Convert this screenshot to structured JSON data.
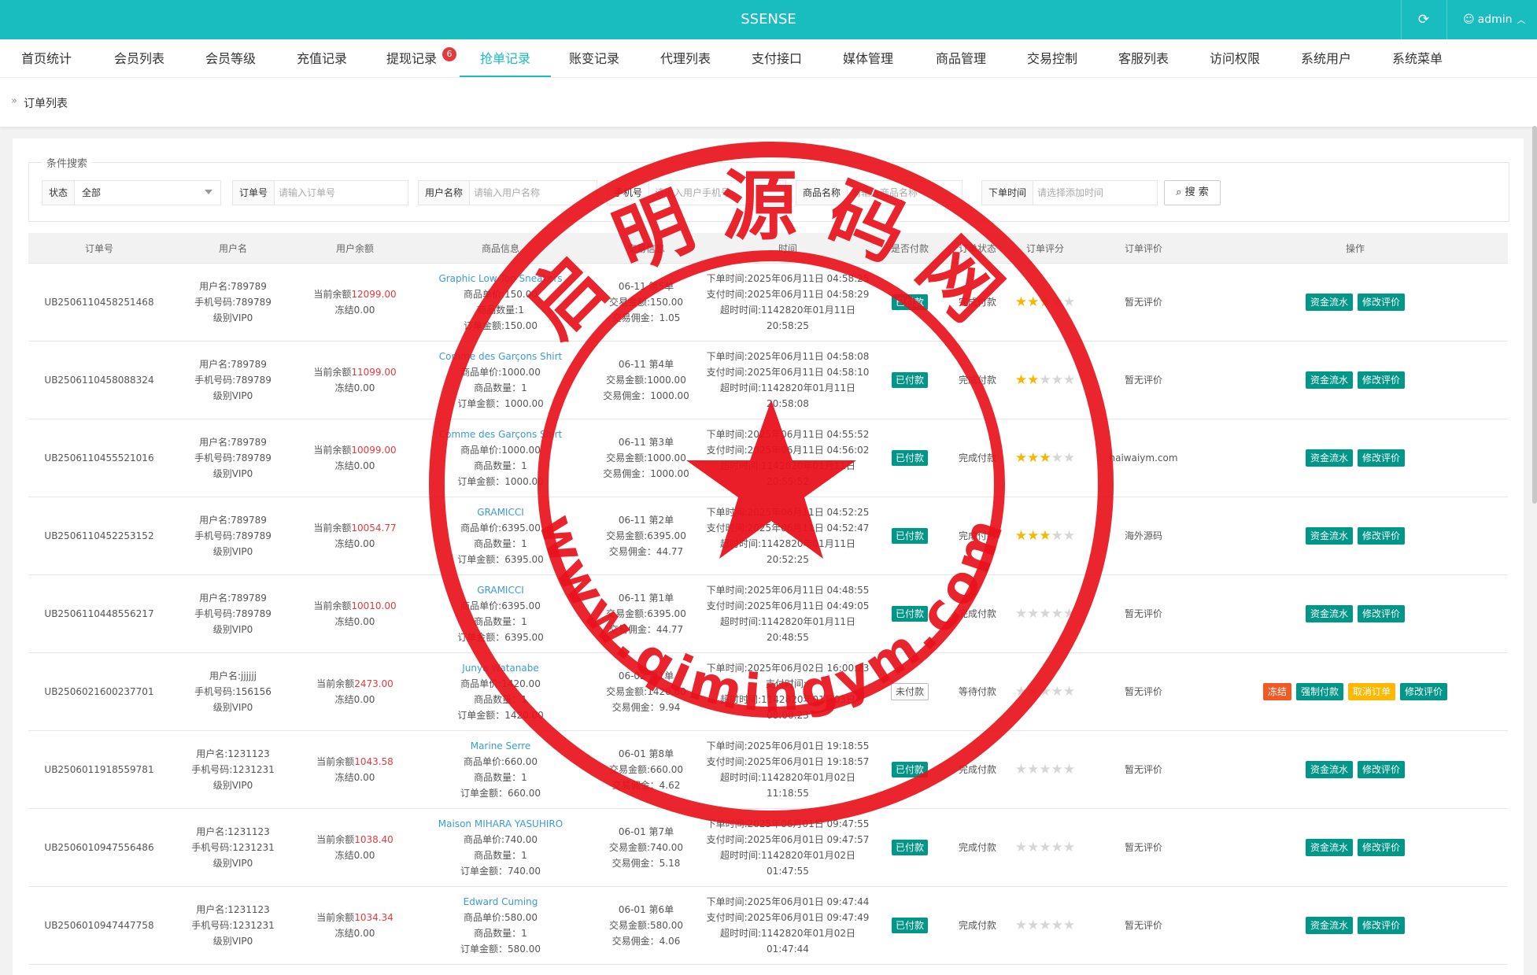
{
  "app": {
    "title": "SSENSE",
    "refresh_icon": "refresh-icon",
    "user": "admin"
  },
  "nav": [
    {
      "label": "首页统计"
    },
    {
      "label": "会员列表"
    },
    {
      "label": "会员等级"
    },
    {
      "label": "充值记录"
    },
    {
      "label": "提现记录",
      "badge": "6"
    },
    {
      "label": "抢单记录",
      "active": true
    },
    {
      "label": "账变记录"
    },
    {
      "label": "代理列表"
    },
    {
      "label": "支付接口"
    },
    {
      "label": "媒体管理"
    },
    {
      "label": "商品管理"
    },
    {
      "label": "交易控制"
    },
    {
      "label": "客服列表"
    },
    {
      "label": "访问权限"
    },
    {
      "label": "系统用户"
    },
    {
      "label": "系统菜单"
    }
  ],
  "breadcrumb": "订单列表",
  "search": {
    "legend": "条件搜索",
    "status_label": "状态",
    "status_value": "全部",
    "order_label": "订单号",
    "order_placeholder": "请输入订单号",
    "username_label": "用户名称",
    "username_placeholder": "请输入用户名称",
    "phone_label": "手机号",
    "phone_placeholder": "请输入用户手机号",
    "product_label": "商品名称",
    "product_placeholder": "请输入商品名称",
    "time_label": "下单时间",
    "time_placeholder": "请选择添加时间",
    "button": "搜 索"
  },
  "table": {
    "headers": [
      "订单号",
      "用户名",
      "用户余额",
      "商品信息",
      "交易信息",
      "时间",
      "是否付款",
      "订单状态",
      "订单评分",
      "订单评价",
      "操作"
    ],
    "rows": [
      {
        "order_no": "UB2506110458251468",
        "user": [
          "用户名:789789",
          "手机号码:789789",
          "级别VIP0"
        ],
        "balance_prefix": "当前余额",
        "balance": "12099.00",
        "frozen": "冻结0.00",
        "product": "Graphic Low Top Sneakers",
        "product_lines": [
          "商品单价:150.00",
          "商品数量:1",
          "订单金额:150.00"
        ],
        "trade": [
          "06-11 第5单",
          "交易金额:150.00",
          "交易佣金：1.05"
        ],
        "time": [
          "下单时间:2025年06月11日 04:58:25",
          "支付时间:2025年06月11日 04:58:29",
          "超时时间:1142820年01月11日 20:58:25"
        ],
        "paid": "已付款",
        "paid_flag": true,
        "status": "完成付款",
        "rating": 3,
        "review": "暂无评价",
        "actions": [
          "资金流水",
          "修改评价"
        ]
      },
      {
        "order_no": "UB2506110458088324",
        "user": [
          "用户名:789789",
          "手机号码:789789",
          "级别VIP0"
        ],
        "balance_prefix": "当前余额",
        "balance": "11099.00",
        "frozen": "冻结0.00",
        "product": "Comme des Garçons Shirt",
        "product_lines": [
          "商品单价:1000.00",
          "商品数量：1",
          "订单金额：1000.00"
        ],
        "trade": [
          "06-11 第4单",
          "交易金额:1000.00",
          "交易佣金：1000.00"
        ],
        "time": [
          "下单时间:2025年06月11日 04:58:08",
          "支付时间:2025年06月11日 04:58:10",
          "超时时间:1142820年01月11日 20:58:08"
        ],
        "paid": "已付款",
        "paid_flag": true,
        "status": "完成付款",
        "rating": 2,
        "review": "暂无评价",
        "actions": [
          "资金流水",
          "修改评价"
        ]
      },
      {
        "order_no": "UB2506110455521016",
        "user": [
          "用户名:789789",
          "手机号码:789789",
          "级别VIP0"
        ],
        "balance_prefix": "当前余额",
        "balance": "10099.00",
        "frozen": "冻结0.00",
        "product": "Comme des Garçons Shirt",
        "product_lines": [
          "商品单价:1000.00",
          "商品数量：1",
          "订单金额：1000.00"
        ],
        "trade": [
          "06-11 第3单",
          "交易金额:1000.00",
          "交易佣金：1000.00"
        ],
        "time": [
          "下单时间:2025年06月11日 04:55:52",
          "支付时间:2025年06月11日 04:56:02",
          "超时时间:1142820年01月11日 20:55:52"
        ],
        "paid": "已付款",
        "paid_flag": true,
        "status": "完成付款",
        "rating": 3,
        "review": "haiwaiym.com",
        "actions": [
          "资金流水",
          "修改评价"
        ]
      },
      {
        "order_no": "UB2506110452253152",
        "user": [
          "用户名:789789",
          "手机号码:789789",
          "级别VIP0"
        ],
        "balance_prefix": "当前余额",
        "balance": "10054.77",
        "frozen": "冻结0.00",
        "product": "GRAMICCI",
        "product_lines": [
          "商品单价:6395.00",
          "商品数量：1",
          "订单金额：6395.00"
        ],
        "trade": [
          "06-11 第2单",
          "交易金额:6395.00",
          "交易佣金：44.77"
        ],
        "time": [
          "下单时间:2025年06月11日 04:52:25",
          "支付时间:2025年06月11日 04:52:47",
          "超时时间:1142820年01月11日 20:52:25"
        ],
        "paid": "已付款",
        "paid_flag": true,
        "status": "完成付款",
        "rating": 3,
        "review": "海外源码",
        "actions": [
          "资金流水",
          "修改评价"
        ]
      },
      {
        "order_no": "UB2506110448556217",
        "user": [
          "用户名:789789",
          "手机号码:789789",
          "级别VIP0"
        ],
        "balance_prefix": "当前余额",
        "balance": "10010.00",
        "frozen": "冻结0.00",
        "product": "GRAMICCI",
        "product_lines": [
          "商品单价:6395.00",
          "商品数量：1",
          "订单金额：6395.00"
        ],
        "trade": [
          "06-11 第1单",
          "交易金额:6395.00",
          "交易佣金：44.77"
        ],
        "time": [
          "下单时间:2025年06月11日 04:48:55",
          "支付时间:2025年06月11日 04:49:05",
          "超时时间:1142820年01月11日 20:48:55"
        ],
        "paid": "已付款",
        "paid_flag": true,
        "status": "完成付款",
        "rating": 0,
        "review": "暂无评价",
        "actions": [
          "资金流水",
          "修改评价"
        ]
      },
      {
        "order_no": "UB2506021600237701",
        "user": [
          "用户名:jjjjjj",
          "手机号码:156156",
          "级别VIP0"
        ],
        "balance_prefix": "当前余额",
        "balance": "2473.00",
        "frozen": "冻结0.00",
        "product": "Junya Watanabe",
        "product_lines": [
          "商品单价:1420.00",
          "商品数量：1",
          "订单金额：1420.00"
        ],
        "trade": [
          "06-02 第1单",
          "交易金额:1420.00",
          "交易佣金：9.94"
        ],
        "time": [
          "下单时间:2025年06月02日 16:00:23",
          "支付时间:-",
          "超时时间:1142820年01月03日 08:00:23"
        ],
        "paid": "未付款",
        "paid_flag": false,
        "status": "等待付款",
        "rating": 0,
        "review": "暂无评价",
        "actions": [
          "冻结",
          "强制付款",
          "取消订单",
          "修改评价"
        ]
      },
      {
        "order_no": "UB2506011918559781",
        "user": [
          "用户名:1231123",
          "手机号码:1231231",
          "级别VIP0"
        ],
        "balance_prefix": "当前余额",
        "balance": "1043.58",
        "frozen": "冻结0.00",
        "product": "Marine Serre",
        "product_lines": [
          "商品单价:660.00",
          "商品数量：1",
          "订单金额：660.00"
        ],
        "trade": [
          "06-01 第8单",
          "交易金额:660.00",
          "交易佣金：4.62"
        ],
        "time": [
          "下单时间:2025年06月01日 19:18:55",
          "支付时间:2025年06月01日 19:18:57",
          "超时时间:1142820年01月02日 11:18:55"
        ],
        "paid": "已付款",
        "paid_flag": true,
        "status": "完成付款",
        "rating": 0,
        "review": "暂无评价",
        "actions": [
          "资金流水",
          "修改评价"
        ]
      },
      {
        "order_no": "UB2506010947556486",
        "user": [
          "用户名:1231123",
          "手机号码:1231231",
          "级别VIP0"
        ],
        "balance_prefix": "当前余额",
        "balance": "1038.40",
        "frozen": "冻结0.00",
        "product": "Maison MIHARA YASUHIRO",
        "product_lines": [
          "商品单价:740.00",
          "商品数量：1",
          "订单金额：740.00"
        ],
        "trade": [
          "06-01 第7单",
          "交易金额:740.00",
          "交易佣金：5.18"
        ],
        "time": [
          "下单时间:2025年06月01日 09:47:55",
          "支付时间:2025年06月01日 09:47:57",
          "超时时间:1142820年01月02日 01:47:55"
        ],
        "paid": "已付款",
        "paid_flag": true,
        "status": "完成付款",
        "rating": 0,
        "review": "暂无评价",
        "actions": [
          "资金流水",
          "修改评价"
        ]
      },
      {
        "order_no": "UB2506010947447758",
        "user": [
          "用户名:1231123",
          "手机号码:1231231",
          "级别VIP0"
        ],
        "balance_prefix": "当前余额",
        "balance": "1034.34",
        "frozen": "冻结0.00",
        "product": "Edward Cuming",
        "product_lines": [
          "商品单价:580.00",
          "商品数量：1",
          "订单金额：580.00"
        ],
        "trade": [
          "06-01 第6单",
          "交易金额:580.00",
          "交易佣金：4.06"
        ],
        "time": [
          "下单时间:2025年06月01日 09:47:44",
          "支付时间:2025年06月01日 09:47:49",
          "超时时间:1142820年01月02日 01:47:44"
        ],
        "paid": "已付款",
        "paid_flag": true,
        "status": "完成付款",
        "rating": 0,
        "review": "暂无评价",
        "actions": [
          "资金流水",
          "修改评价"
        ]
      }
    ]
  },
  "watermark": {
    "text_cn": "启明源码网",
    "url": "www.qimingym.com",
    "color": "#e8121c"
  }
}
